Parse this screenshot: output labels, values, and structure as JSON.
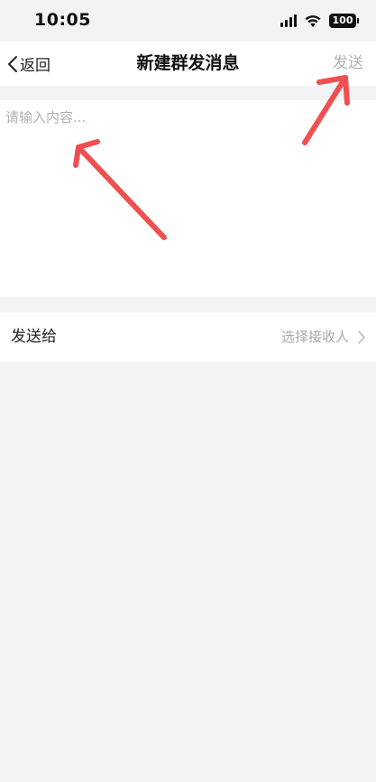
{
  "status_bar": {
    "time": "10:05",
    "battery_level": "100",
    "icons": [
      "signal-icon",
      "wifi-icon",
      "battery-icon"
    ]
  },
  "nav": {
    "back_label": "返回",
    "title": "新建群发消息",
    "send_label": "发送"
  },
  "compose": {
    "placeholder": "请输入内容...",
    "value": ""
  },
  "recipient": {
    "label": "发送给",
    "value": "选择接收人"
  },
  "colors": {
    "background": "#f2f3f5",
    "panel": "#ffffff",
    "annotation_arrow": "#ef4f4f",
    "disabled_text": "#b2b2b2"
  }
}
